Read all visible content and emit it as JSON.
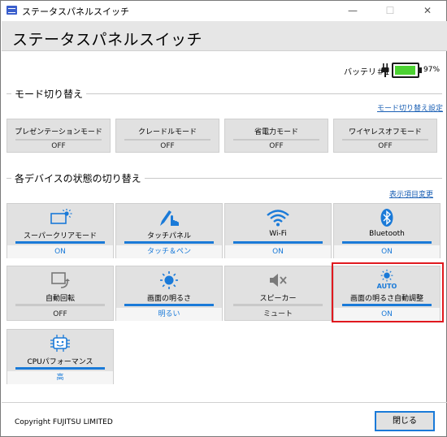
{
  "window": {
    "title": "ステータスパネルスイッチ",
    "minimize": "—",
    "maximize": "☐",
    "close": "✕"
  },
  "header": {
    "title": "ステータスパネルスイッチ"
  },
  "battery": {
    "label": "バッテリ＃1",
    "percent": "97%",
    "level": 0.97,
    "color": "#4cd232"
  },
  "mode_section": {
    "title": "モード切り替え",
    "settings_link": "モード切り替え設定",
    "tiles": [
      {
        "label": "プレゼンテーションモード",
        "state": "OFF"
      },
      {
        "label": "クレードルモード",
        "state": "OFF"
      },
      {
        "label": "省電力モード",
        "state": "OFF"
      },
      {
        "label": "ワイヤレスオフモード",
        "state": "OFF"
      }
    ]
  },
  "device_section": {
    "title": "各デバイスの状態の切り替え",
    "settings_link": "表示項目変更",
    "tiles": [
      {
        "label": "スーパークリアモード",
        "state": "ON",
        "on": true,
        "icon": "screen-sun-icon"
      },
      {
        "label": "タッチパネル",
        "state": "タッチ＆ペン",
        "on": true,
        "icon": "touch-pen-icon"
      },
      {
        "label": "Wi-Fi",
        "state": "ON",
        "on": true,
        "icon": "wifi-icon"
      },
      {
        "label": "Bluetooth",
        "state": "ON",
        "on": true,
        "icon": "bluetooth-icon"
      },
      {
        "label": "自動回転",
        "state": "OFF",
        "on": false,
        "icon": "auto-rotate-icon"
      },
      {
        "label": "画面の明るさ",
        "state": "明るい",
        "on": true,
        "icon": "brightness-icon"
      },
      {
        "label": "スピーカー",
        "state": "ミュート",
        "on": false,
        "icon": "speaker-mute-icon"
      },
      {
        "label": "画面の明るさ自動調整",
        "state": "ON",
        "on": true,
        "icon": "auto-brightness-icon",
        "icon_text": "AUTO"
      },
      {
        "label": "CPUパフォーマンス",
        "state": "高",
        "on": true,
        "icon": "cpu-performance-icon"
      }
    ]
  },
  "footer": {
    "copyright": "Copyright FUJITSU LIMITED",
    "close_label": "閉じる"
  },
  "colors": {
    "accent": "#1a7ad8",
    "highlight": "#e0191f",
    "tile_bg": "#e1e1e1"
  }
}
